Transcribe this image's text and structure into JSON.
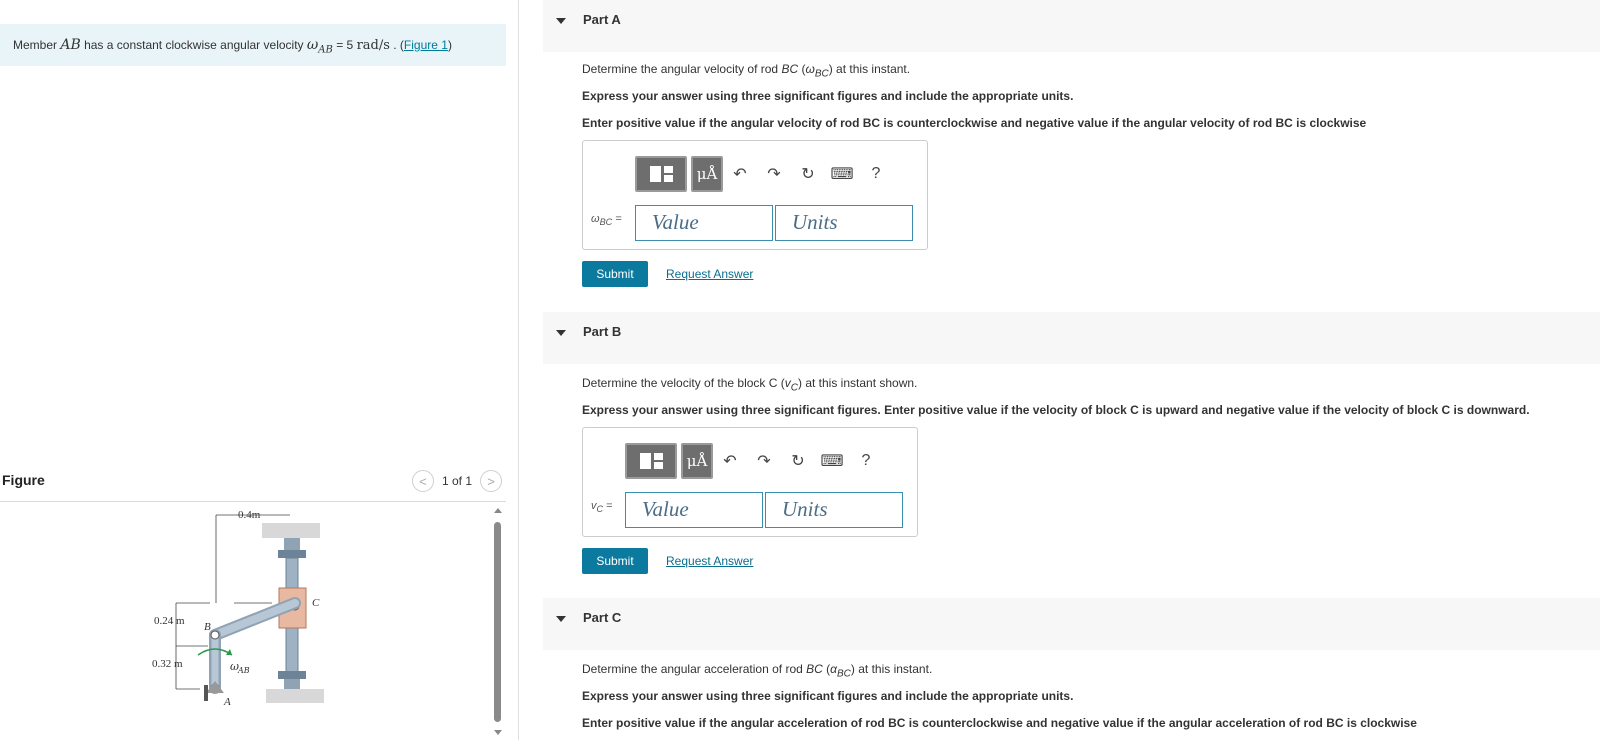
{
  "problem": {
    "text1": "Member ",
    "member": "AB",
    "text2": " has a constant clockwise angular velocity ",
    "omega": "ω",
    "omega_sub": "AB",
    "eq": " = 5 ",
    "unit": "rad/s",
    "text3": " . (",
    "link": "Figure 1",
    "text4": ")"
  },
  "figure": {
    "title": "Figure",
    "pager": "1 of 1",
    "prev": "<",
    "next": ">",
    "labels": {
      "dim_top": "0.4m",
      "dim_a": "0.24 m",
      "dim_b": "0.32 m",
      "B": "B",
      "C": "C",
      "A": "A",
      "omega": "ω",
      "omega_sub": "AB"
    }
  },
  "colors": {
    "accent": "#0b7a9e",
    "problem_bg": "#e8f4f8",
    "input_border": "#3a8fb0"
  },
  "parts": [
    {
      "title": "Part A",
      "q1_pre": "Determine the angular velocity of rod ",
      "q1_rod": "BC",
      "q1_mid": " (",
      "q1_sym": "ω",
      "q1_sub": "BC",
      "q1_post": ") at this instant.",
      "q2": "Express your answer using three significant figures and include the appropriate units.",
      "q3": "Enter positive value if the angular velocity of rod BC is counterclockwise and negative value if the angular velocity of rod BC is clockwise",
      "var_sym": "ω",
      "var_sub": "BC",
      "var_eq": " =",
      "value_placeholder": "Value",
      "units_placeholder": "Units",
      "submit": "Submit",
      "request": "Request Answer"
    },
    {
      "title": "Part B",
      "q1_pre": "Determine the velocity of the block C (",
      "q1_sym": "v",
      "q1_sub": "C",
      "q1_post": ") at this instant shown.",
      "q2": "Express your answer using three significant figures. Enter positive value if the velocity of block C is upward and negative value if the velocity of block C is downward.",
      "var_sym": "v",
      "var_sub": "C",
      "var_eq": " =",
      "value_placeholder": "Value",
      "units_placeholder": "Units",
      "submit": "Submit",
      "request": "Request Answer"
    },
    {
      "title": "Part C",
      "q1_pre": "Determine the angular acceleration of rod ",
      "q1_rod": "BC",
      "q1_mid": " (",
      "q1_sym": "α",
      "q1_sub": "BC",
      "q1_post": ") at this instant.",
      "q2": "Express your answer using three significant figures and include the appropriate units.",
      "q3": "Enter positive value if the angular acceleration of rod BC is counterclockwise and negative value if the angular acceleration of rod BC is clockwise"
    }
  ],
  "toolbar": {
    "units_btn": "μÅ",
    "undo_icon": "↶",
    "redo_icon": "↷",
    "reset_icon": "↻",
    "keyboard_icon": "⌨",
    "help": "?"
  }
}
